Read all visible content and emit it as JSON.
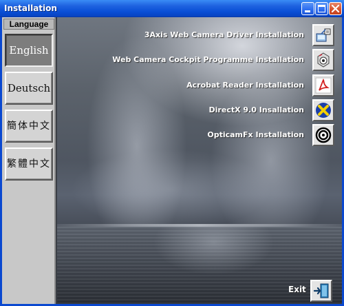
{
  "window": {
    "title": "Installation"
  },
  "sidebar": {
    "header": "Language",
    "languages": [
      {
        "label": "English",
        "active": true
      },
      {
        "label": "Deutsch",
        "active": false
      },
      {
        "label": "簡体中文",
        "active": false
      },
      {
        "label": "繁體中文",
        "active": false
      }
    ]
  },
  "menu": {
    "items": [
      {
        "label": "3Axis Web Camera Driver Installation",
        "icon": "camera-driver-icon"
      },
      {
        "label": "Web Camera Cockpit Programme Installation",
        "icon": "cockpit-icon"
      },
      {
        "label": "Acrobat Reader Installation",
        "icon": "acrobat-icon"
      },
      {
        "label": "DirectX 9.0 Insallation",
        "icon": "directx-icon"
      },
      {
        "label": "OpticamFx Installation",
        "icon": "opticam-icon"
      }
    ]
  },
  "exit": {
    "label": "Exit",
    "icon": "exit-door-icon"
  },
  "colors": {
    "titlebar": "#0a4fd6",
    "sidebar_bg": "#c8c8c8",
    "active_language_bg": "#7d7d7d",
    "label_text": "#ffffff"
  }
}
